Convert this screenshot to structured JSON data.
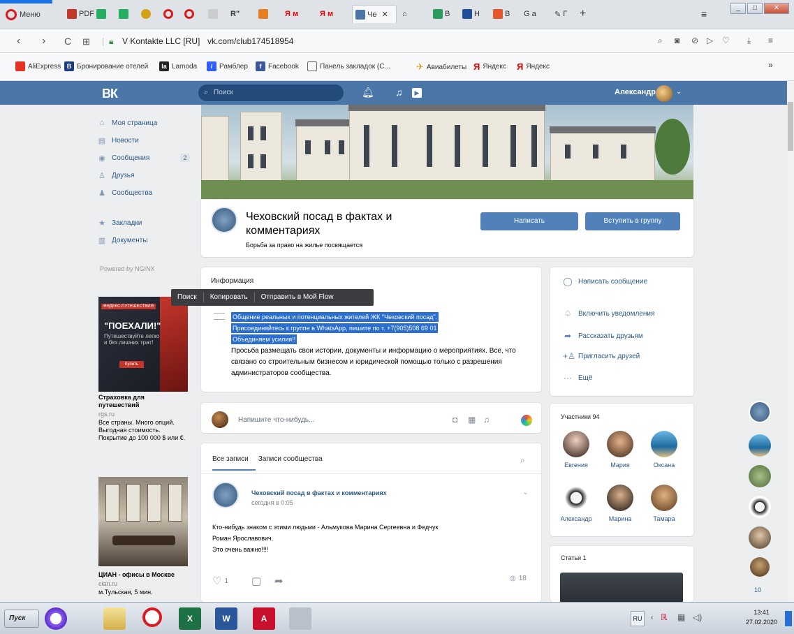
{
  "browser": {
    "menu_label": "Меню",
    "tabs": [
      "PDF",
      "",
      "",
      "",
      "",
      "",
      "",
      "R\"",
      "",
      "Я м",
      "Я м",
      "Чe",
      "",
      "В",
      "Н",
      "В",
      "G а",
      "Г",
      "+"
    ],
    "active_tab_index": 11,
    "site_info": "V Kontakte LLC [RU]",
    "url": "vk.com/club174518954",
    "bookmarks": [
      "AliExpress",
      "Бронирование отелей",
      "Lamoda",
      "Рамблер",
      "Facebook",
      "Панель закладок (С...",
      "Авиабилеты",
      "Яндекс",
      "Яндекс"
    ],
    "more_bookmarks": "»"
  },
  "vk": {
    "logo": "ВК",
    "search_placeholder": "Поиск",
    "user_name": "Александр"
  },
  "left_menu": {
    "items": [
      {
        "label": "Моя страница",
        "icon": "home-icon"
      },
      {
        "label": "Новости",
        "icon": "news-icon"
      },
      {
        "label": "Сообщения",
        "icon": "messages-icon",
        "badge": "2"
      },
      {
        "label": "Друзья",
        "icon": "friends-icon"
      },
      {
        "label": "Сообщества",
        "icon": "groups-icon"
      },
      {
        "label": "Закладки",
        "icon": "star-icon"
      },
      {
        "label": "Документы",
        "icon": "documents-icon"
      }
    ],
    "powered": "Powered by NGINX"
  },
  "ads": [
    {
      "image_headline": "\"ПОЕХАЛИ!\"",
      "image_sub": "Путешествуйте легко и без лишних трат!",
      "image_tag": "ЯНДЕКС.ПУТЕШЕСТВИЯ",
      "image_button": "Купить",
      "title": "Страховка для путешествий",
      "domain": "rgs.ru",
      "desc": "Все страны. Много опций. Выгодная стоимость. Покрытие до 100 000 $ или €."
    },
    {
      "title": "ЦИАН - офисы в Москве",
      "domain": "cian.ru",
      "desc": "м.Тульская, 5 мин."
    }
  ],
  "group": {
    "name": "Чеховский посад в фактах и комментариях",
    "status": "Борьба за право на жилье посвящается",
    "write_button": "Написать",
    "join_button": "Вступить в группу"
  },
  "info": {
    "header": "Информация",
    "selected_lines": [
      "Общение реальных и потенциальных жителей ЖК \"Чеховский посад\".",
      "Присоединяйтесь к группе в WhatsApp, пишите по т. +7(905)508 69 01",
      "Объединяем усилия!!"
    ],
    "text": "Просьба размещать свои истории, документы и информацию о мероприятиях. Все, что связано со строительным бизнесом и юридической помощью только с разрешения администраторов сообщества."
  },
  "context_menu": {
    "items": [
      "Поиск",
      "Копировать",
      "Отправить в Мой Flow"
    ]
  },
  "actions": [
    {
      "label": "Написать сообщение",
      "icon": "message-icon"
    },
    {
      "label": "Включить уведомления",
      "icon": "bell-icon"
    },
    {
      "label": "Рассказать друзьям",
      "icon": "share-icon"
    },
    {
      "label": "Пригласить друзей",
      "icon": "invite-icon"
    },
    {
      "label": "Ещё",
      "icon": "more-icon"
    }
  ],
  "composer": {
    "placeholder": "Напишите что-нибудь..."
  },
  "wall_tabs": [
    "Все записи",
    "Записи сообщества"
  ],
  "post": {
    "author": "Чеховский посад в фактах и комментариях",
    "date": "сегодня в 0:05",
    "lines": [
      "Кто-нибудь знаком с этими людьми - Альмукова Марина Сергеевна и Федчук",
      "Роман Ярославович.",
      "Это очень важно!!!!"
    ],
    "likes": "1",
    "views": "18"
  },
  "members": {
    "header": "Участники 94",
    "people": [
      "Евгения",
      "Мария",
      "Оксана",
      "Александр",
      "Марина",
      "Тамара"
    ]
  },
  "articles": {
    "header": "Статьи 1"
  },
  "floating": {
    "count": "10"
  },
  "taskbar": {
    "start": "Пуск",
    "lang": "RU",
    "time": "13:41",
    "date": "27.02.2020"
  },
  "colors": {
    "vk_blue": "#4a76a8",
    "button_blue": "#5181b8",
    "link": "#2a5885",
    "selection": "#2b6ed1"
  }
}
